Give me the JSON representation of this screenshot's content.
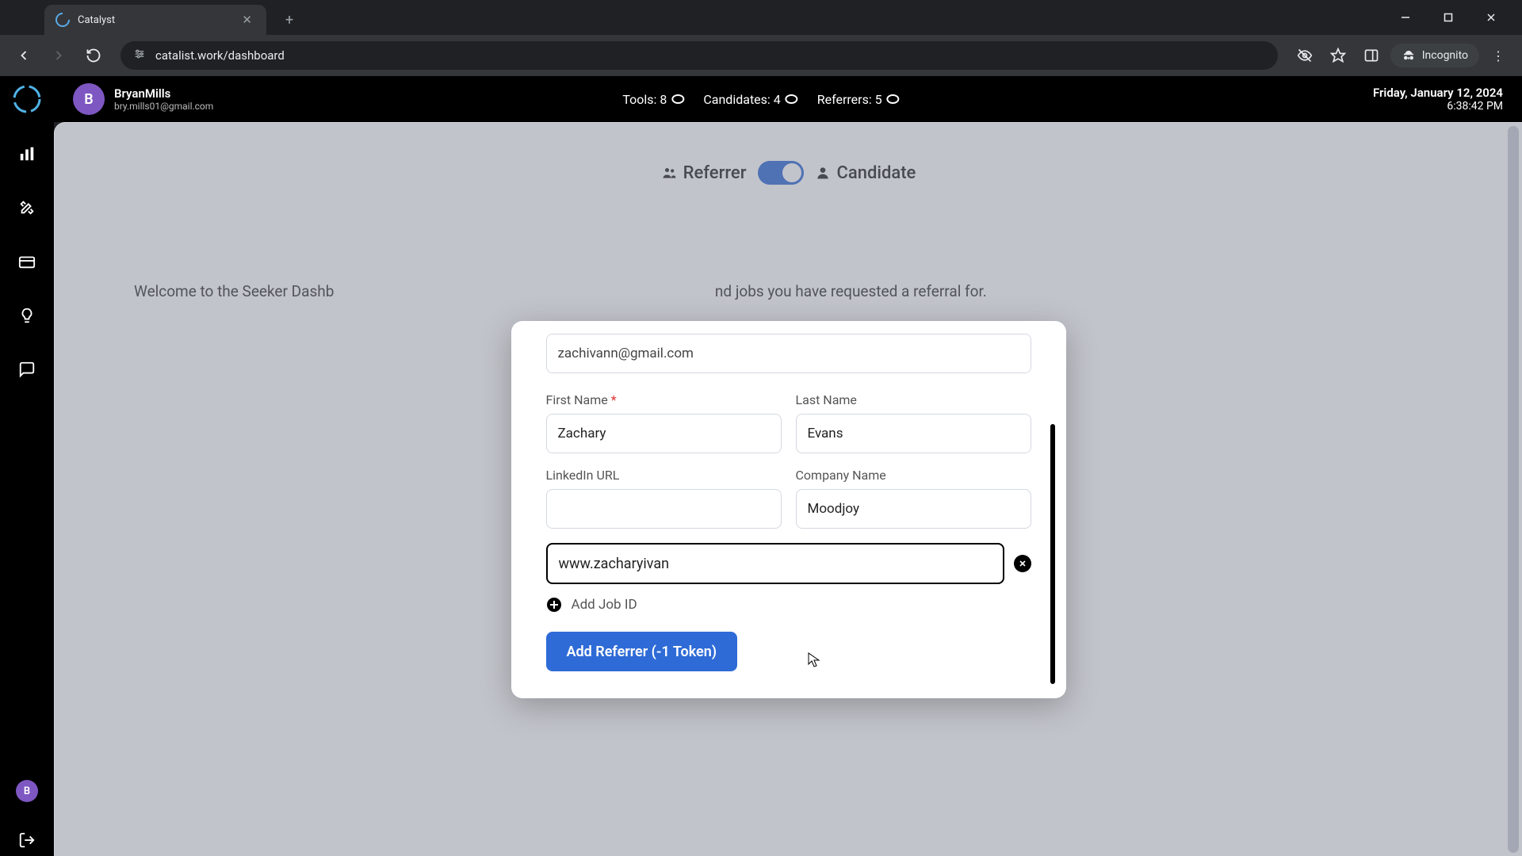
{
  "browser": {
    "tab_title": "Catalyst",
    "url": "catalist.work/dashboard",
    "incognito_label": "Incognito"
  },
  "header": {
    "user_initial": "B",
    "user_name": "BryanMills",
    "user_email": "bry.mills01@gmail.com",
    "stats": {
      "tools_label": "Tools: 8",
      "candidates_label": "Candidates: 4",
      "referrers_label": "Referrers: 5"
    },
    "date": "Friday, January 12, 2024",
    "time": "6:38:42 PM"
  },
  "sidebar": {
    "bottom_avatar_initial": "B"
  },
  "page": {
    "toggle_left": "Referrer",
    "toggle_right": "Candidate",
    "welcome_text_left": "Welcome to the Seeker Dashb",
    "welcome_text_right": "nd jobs you have requested a referral for."
  },
  "modal": {
    "email_value": "zachivann@gmail.com",
    "first_name_label": "First Name",
    "first_name_value": "Zachary",
    "last_name_label": "Last Name",
    "last_name_value": "Evans",
    "linkedin_label": "LinkedIn URL",
    "linkedin_value": "",
    "company_label": "Company Name",
    "company_value": "Moodjoy",
    "url_value": "www.zacharyivan",
    "add_job_label": "Add Job ID",
    "submit_label": "Add Referrer (-1 Token)",
    "required_mark": "*"
  }
}
